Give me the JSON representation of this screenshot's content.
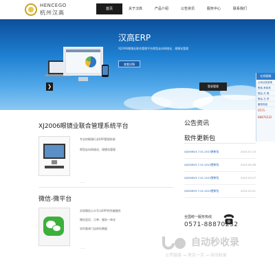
{
  "logo": {
    "en": "HENCEGO",
    "cn": "杭州汉高"
  },
  "nav": [
    "首页",
    "关于汉高",
    "产品介绍",
    "公告资讯",
    "服务中心",
    "联系我们"
  ],
  "banner": {
    "title": "汉高ERP",
    "desc": "XJ2006眼镜业联合管理平台帮您走向网络化、规模化管理",
    "button": "查看详情",
    "login_button": "登录管理",
    "arrow": "❯"
  },
  "side_widget": {
    "head": "在线客服",
    "rows": [
      "公司业务咨询",
      "售前-肖军亮",
      "售后-方 燕",
      "售后-王 芳",
      "服务热线"
    ],
    "tel": "0571-88870232"
  },
  "product1": {
    "title": "XJ2006眼镜业联合管理系统平台",
    "lines": [
      "专业的眼镜行业ERP管理系统",
      "帮您走向网络化、规模化管理"
    ],
    "more": "……"
  },
  "product2": {
    "title": "微信-微平台",
    "lines": [
      "实现微信公众号与ERP的完美融合",
      "微信会员、订单、服务一体化",
      "实时查询门店库存数据"
    ],
    "more": "……"
  },
  "news": {
    "title": "公告资讯",
    "subtitle": "软件更新包",
    "items": [
      {
        "link": "XJ2006V3.7.01.2015更新包",
        "date": "2015-07-13"
      },
      {
        "link": "XJ2006V3.7.01.2015更新包",
        "date": "2015-05-06"
      },
      {
        "link": "XJ2006V3.7.01.2015更新包",
        "date": "2015-03-27"
      },
      {
        "link": "XJ2006V3.7.01.2015更新包",
        "date": "2015-03-21"
      }
    ]
  },
  "hotline": {
    "label": "全国统一服务热线",
    "number": "0571-88870232"
  },
  "watermark": {
    "text": "自动秒收录",
    "sub": "上传链接 → 来访一次 → 自动收录"
  }
}
